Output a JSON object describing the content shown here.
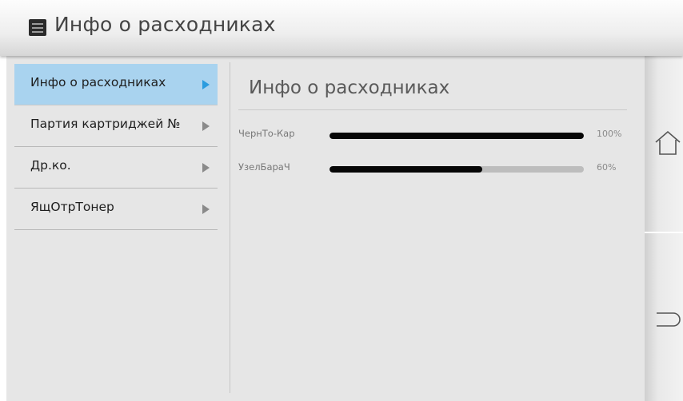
{
  "header": {
    "title": "Инфо о расходниках",
    "menu_icon": "menu-icon"
  },
  "sidebar": {
    "items": [
      {
        "label": "Инфо о расходниках",
        "active": true
      },
      {
        "label": "Партия картриджей №",
        "active": false
      },
      {
        "label": "Др.ко.",
        "active": false
      },
      {
        "label": "ЯщОтрТонер",
        "active": false
      }
    ]
  },
  "content": {
    "title": "Инфо о расходниках",
    "consumables": [
      {
        "label": "ЧернТо-Кар",
        "percent_text": "100%",
        "level": 1.0
      },
      {
        "label": "УзелБараЧ",
        "percent_text": "60%",
        "level": 0.6
      }
    ]
  },
  "nav": {
    "home_icon": "home-icon",
    "back_icon": "back-icon"
  },
  "colors": {
    "active_item_bg": "#a9d3ef",
    "active_arrow": "#2a9cdf",
    "bar_fill": "#060606",
    "bar_track": "#bdbdbd",
    "panel_bg": "#e6e6e6"
  }
}
